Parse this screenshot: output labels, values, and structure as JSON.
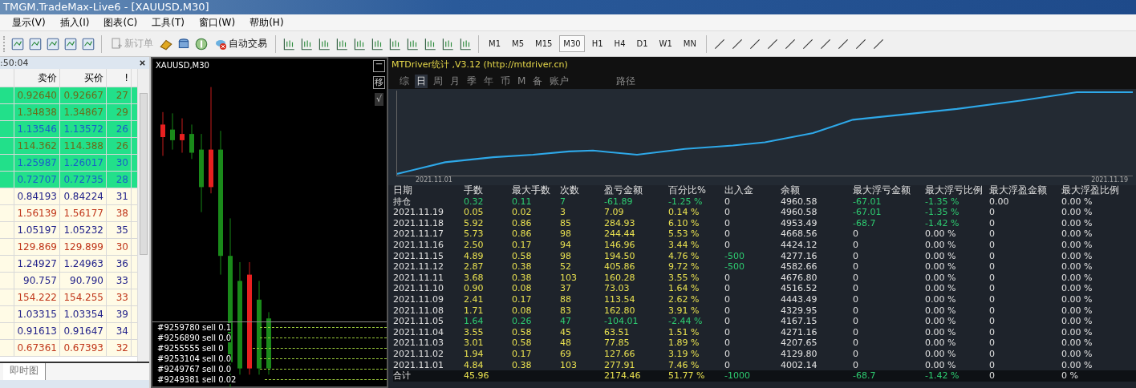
{
  "window": {
    "title": "TMGM.TradeMax-Live6 - [XAUUSD,M30]"
  },
  "menu": [
    "显示(V)",
    "插入(I)",
    "图表(C)",
    "工具(T)",
    "窗口(W)",
    "帮助(H)"
  ],
  "toolbar": {
    "new_order": {
      "label": "新订单",
      "disabled": true
    },
    "auto_trading": {
      "label": "自动交易"
    },
    "timeframes": [
      {
        "label": "M1",
        "selected": false
      },
      {
        "label": "M5",
        "selected": false
      },
      {
        "label": "M15",
        "selected": false
      },
      {
        "label": "M30",
        "selected": true
      },
      {
        "label": "H1",
        "selected": false
      },
      {
        "label": "H4",
        "selected": false
      },
      {
        "label": "D1",
        "selected": false
      },
      {
        "label": "W1",
        "selected": false
      },
      {
        "label": "MN",
        "selected": false
      }
    ]
  },
  "market_watch": {
    "time": ":50:04",
    "columns": [
      "卖价",
      "买价",
      "!"
    ],
    "rows": [
      {
        "bid": "0.92640",
        "ask": "0.92667",
        "spread": "27",
        "highlighted": true,
        "color": "#6b6b1a"
      },
      {
        "bid": "1.34838",
        "ask": "1.34867",
        "spread": "29",
        "highlighted": true,
        "color": "#6b6b1a"
      },
      {
        "bid": "1.13546",
        "ask": "1.13572",
        "spread": "26",
        "highlighted": true,
        "color": "#1a5fc8"
      },
      {
        "bid": "114.362",
        "ask": "114.388",
        "spread": "26",
        "highlighted": true,
        "color": "#6b6b1a"
      },
      {
        "bid": "1.25987",
        "ask": "1.26017",
        "spread": "30",
        "highlighted": true,
        "color": "#1a5fc8"
      },
      {
        "bid": "0.72707",
        "ask": "0.72735",
        "spread": "28",
        "highlighted": true,
        "color": "#1a5fc8"
      },
      {
        "bid": "0.84193",
        "ask": "0.84224",
        "spread": "31",
        "highlighted": false,
        "color": "#22228a"
      },
      {
        "bid": "1.56139",
        "ask": "1.56177",
        "spread": "38",
        "highlighted": false,
        "color": "#c0361a"
      },
      {
        "bid": "1.05197",
        "ask": "1.05232",
        "spread": "35",
        "highlighted": false,
        "color": "#22228a"
      },
      {
        "bid": "129.869",
        "ask": "129.899",
        "spread": "30",
        "highlighted": false,
        "color": "#c0361a"
      },
      {
        "bid": "1.24927",
        "ask": "1.24963",
        "spread": "36",
        "highlighted": false,
        "color": "#22228a"
      },
      {
        "bid": "90.757",
        "ask": "90.790",
        "spread": "33",
        "highlighted": false,
        "color": "#22228a"
      },
      {
        "bid": "154.222",
        "ask": "154.255",
        "spread": "33",
        "highlighted": false,
        "color": "#c0361a"
      },
      {
        "bid": "1.03315",
        "ask": "1.03354",
        "spread": "39",
        "highlighted": false,
        "color": "#22228a"
      },
      {
        "bid": "0.91613",
        "ask": "0.91647",
        "spread": "34",
        "highlighted": false,
        "color": "#22228a"
      },
      {
        "bid": "0.67361",
        "ask": "0.67393",
        "spread": "32",
        "highlighted": false,
        "color": "#c0361a"
      }
    ],
    "tabs": [
      "即时图"
    ]
  },
  "chart": {
    "symbol": "XAUUSD,M30",
    "side_buttons": [
      "移",
      "√"
    ],
    "orders": [
      "#9259780 sell 0.1",
      "#9256890 sell 0.0",
      "#9255555 sell 0",
      "#9253104 sell 0.0",
      "#9249767 sell 0.0",
      "#9249381 sell 0.02"
    ]
  },
  "stats": {
    "title": "MTDriver统计 ,V3.12 (http://mtdriver.cn)",
    "tabs": [
      {
        "label": "综",
        "selected": false
      },
      {
        "label": "日",
        "selected": true
      },
      {
        "label": "周",
        "selected": false
      },
      {
        "label": "月",
        "selected": false
      },
      {
        "label": "季",
        "selected": false
      },
      {
        "label": "年",
        "selected": false
      },
      {
        "label": "币",
        "selected": false
      },
      {
        "label": "M",
        "selected": false
      },
      {
        "label": "备",
        "selected": false
      },
      {
        "label": "账户",
        "selected": false
      },
      {
        "label": "路径",
        "selected": false
      }
    ],
    "curve_start": "2021.11.01",
    "curve_end": "2021.11.19",
    "columns": [
      "日期",
      "手数",
      "最大手数",
      "次数",
      "盈亏金额",
      "百分比%",
      "出入金",
      "余额",
      "最大浮亏金额",
      "最大浮亏比例",
      "最大浮盈金额",
      "最大浮盈比例"
    ],
    "rows": [
      [
        {
          "v": "持仓"
        },
        {
          "v": "0.32",
          "color": "#2ecc71"
        },
        {
          "v": "0.11",
          "color": "#2ecc71"
        },
        {
          "v": "7",
          "color": "#2ecc71"
        },
        {
          "v": "-61.89",
          "color": "#2ecc71"
        },
        {
          "v": "-1.25 %",
          "color": "#2ecc71"
        },
        {
          "v": "0",
          "color": "#e0e0e0"
        },
        {
          "v": "4960.58",
          "color": "#e0e0e0"
        },
        {
          "v": "-67.01",
          "color": "#2ecc71"
        },
        {
          "v": "-1.35 %",
          "color": "#2ecc71"
        },
        {
          "v": "0.00",
          "color": "#e0e0e0"
        },
        {
          "v": "0.00 %",
          "color": "#e0e0e0"
        }
      ],
      [
        {
          "v": "2021.11.19",
          "color": "#e0e0e0"
        },
        {
          "v": "0.05",
          "color": "#e8e050"
        },
        {
          "v": "0.02",
          "color": "#e8e050"
        },
        {
          "v": "3",
          "color": "#e8e050"
        },
        {
          "v": "7.09",
          "color": "#e8e050"
        },
        {
          "v": "0.14 %",
          "color": "#e8e050"
        },
        {
          "v": "0",
          "color": "#e0e0e0"
        },
        {
          "v": "4960.58",
          "color": "#e0e0e0"
        },
        {
          "v": "-67.01",
          "color": "#2ecc71"
        },
        {
          "v": "-1.35 %",
          "color": "#2ecc71"
        },
        {
          "v": "0",
          "color": "#e0e0e0"
        },
        {
          "v": "0.00 %",
          "color": "#e0e0e0"
        }
      ],
      [
        {
          "v": "2021.11.18",
          "color": "#e0e0e0"
        },
        {
          "v": "5.92",
          "color": "#e8e050"
        },
        {
          "v": "0.86",
          "color": "#e8e050"
        },
        {
          "v": "85",
          "color": "#e8e050"
        },
        {
          "v": "284.93",
          "color": "#e8e050"
        },
        {
          "v": "6.10 %",
          "color": "#e8e050"
        },
        {
          "v": "0",
          "color": "#e0e0e0"
        },
        {
          "v": "4953.49",
          "color": "#e0e0e0"
        },
        {
          "v": "-68.7",
          "color": "#2ecc71"
        },
        {
          "v": "-1.42 %",
          "color": "#2ecc71"
        },
        {
          "v": "0",
          "color": "#e0e0e0"
        },
        {
          "v": "0.00 %",
          "color": "#e0e0e0"
        }
      ],
      [
        {
          "v": "2021.11.17",
          "color": "#e0e0e0"
        },
        {
          "v": "5.73",
          "color": "#e8e050"
        },
        {
          "v": "0.86",
          "color": "#e8e050"
        },
        {
          "v": "98",
          "color": "#e8e050"
        },
        {
          "v": "244.44",
          "color": "#e8e050"
        },
        {
          "v": "5.53 %",
          "color": "#e8e050"
        },
        {
          "v": "0",
          "color": "#e0e0e0"
        },
        {
          "v": "4668.56",
          "color": "#e0e0e0"
        },
        {
          "v": "0",
          "color": "#e0e0e0"
        },
        {
          "v": "0.00 %",
          "color": "#e0e0e0"
        },
        {
          "v": "0",
          "color": "#e0e0e0"
        },
        {
          "v": "0.00 %",
          "color": "#e0e0e0"
        }
      ],
      [
        {
          "v": "2021.11.16",
          "color": "#e0e0e0"
        },
        {
          "v": "2.50",
          "color": "#e8e050"
        },
        {
          "v": "0.17",
          "color": "#e8e050"
        },
        {
          "v": "94",
          "color": "#e8e050"
        },
        {
          "v": "146.96",
          "color": "#e8e050"
        },
        {
          "v": "3.44 %",
          "color": "#e8e050"
        },
        {
          "v": "0",
          "color": "#e0e0e0"
        },
        {
          "v": "4424.12",
          "color": "#e0e0e0"
        },
        {
          "v": "0",
          "color": "#e0e0e0"
        },
        {
          "v": "0.00 %",
          "color": "#e0e0e0"
        },
        {
          "v": "0",
          "color": "#e0e0e0"
        },
        {
          "v": "0.00 %",
          "color": "#e0e0e0"
        }
      ],
      [
        {
          "v": "2021.11.15",
          "color": "#e0e0e0"
        },
        {
          "v": "4.89",
          "color": "#e8e050"
        },
        {
          "v": "0.58",
          "color": "#e8e050"
        },
        {
          "v": "98",
          "color": "#e8e050"
        },
        {
          "v": "194.50",
          "color": "#e8e050"
        },
        {
          "v": "4.76 %",
          "color": "#e8e050"
        },
        {
          "v": "-500",
          "color": "#2ecc71"
        },
        {
          "v": "4277.16",
          "color": "#e0e0e0"
        },
        {
          "v": "0",
          "color": "#e0e0e0"
        },
        {
          "v": "0.00 %",
          "color": "#e0e0e0"
        },
        {
          "v": "0",
          "color": "#e0e0e0"
        },
        {
          "v": "0.00 %",
          "color": "#e0e0e0"
        }
      ],
      [
        {
          "v": "2021.11.12",
          "color": "#e0e0e0"
        },
        {
          "v": "2.87",
          "color": "#e8e050"
        },
        {
          "v": "0.38",
          "color": "#e8e050"
        },
        {
          "v": "52",
          "color": "#e8e050"
        },
        {
          "v": "405.86",
          "color": "#e8e050"
        },
        {
          "v": "9.72 %",
          "color": "#e8e050"
        },
        {
          "v": "-500",
          "color": "#2ecc71"
        },
        {
          "v": "4582.66",
          "color": "#e0e0e0"
        },
        {
          "v": "0",
          "color": "#e0e0e0"
        },
        {
          "v": "0.00 %",
          "color": "#e0e0e0"
        },
        {
          "v": "0",
          "color": "#e0e0e0"
        },
        {
          "v": "0.00 %",
          "color": "#e0e0e0"
        }
      ],
      [
        {
          "v": "2021.11.11",
          "color": "#e0e0e0"
        },
        {
          "v": "3.68",
          "color": "#e8e050"
        },
        {
          "v": "0.38",
          "color": "#e8e050"
        },
        {
          "v": "103",
          "color": "#e8e050"
        },
        {
          "v": "160.28",
          "color": "#e8e050"
        },
        {
          "v": "3.55 %",
          "color": "#e8e050"
        },
        {
          "v": "0",
          "color": "#e0e0e0"
        },
        {
          "v": "4676.80",
          "color": "#e0e0e0"
        },
        {
          "v": "0",
          "color": "#e0e0e0"
        },
        {
          "v": "0.00 %",
          "color": "#e0e0e0"
        },
        {
          "v": "0",
          "color": "#e0e0e0"
        },
        {
          "v": "0.00 %",
          "color": "#e0e0e0"
        }
      ],
      [
        {
          "v": "2021.11.10",
          "color": "#e0e0e0"
        },
        {
          "v": "0.90",
          "color": "#e8e050"
        },
        {
          "v": "0.08",
          "color": "#e8e050"
        },
        {
          "v": "37",
          "color": "#e8e050"
        },
        {
          "v": "73.03",
          "color": "#e8e050"
        },
        {
          "v": "1.64 %",
          "color": "#e8e050"
        },
        {
          "v": "0",
          "color": "#e0e0e0"
        },
        {
          "v": "4516.52",
          "color": "#e0e0e0"
        },
        {
          "v": "0",
          "color": "#e0e0e0"
        },
        {
          "v": "0.00 %",
          "color": "#e0e0e0"
        },
        {
          "v": "0",
          "color": "#e0e0e0"
        },
        {
          "v": "0.00 %",
          "color": "#e0e0e0"
        }
      ],
      [
        {
          "v": "2021.11.09",
          "color": "#e0e0e0"
        },
        {
          "v": "2.41",
          "color": "#e8e050"
        },
        {
          "v": "0.17",
          "color": "#e8e050"
        },
        {
          "v": "88",
          "color": "#e8e050"
        },
        {
          "v": "113.54",
          "color": "#e8e050"
        },
        {
          "v": "2.62 %",
          "color": "#e8e050"
        },
        {
          "v": "0",
          "color": "#e0e0e0"
        },
        {
          "v": "4443.49",
          "color": "#e0e0e0"
        },
        {
          "v": "0",
          "color": "#e0e0e0"
        },
        {
          "v": "0.00 %",
          "color": "#e0e0e0"
        },
        {
          "v": "0",
          "color": "#e0e0e0"
        },
        {
          "v": "0.00 %",
          "color": "#e0e0e0"
        }
      ],
      [
        {
          "v": "2021.11.08",
          "color": "#e0e0e0"
        },
        {
          "v": "1.71",
          "color": "#e8e050"
        },
        {
          "v": "0.08",
          "color": "#e8e050"
        },
        {
          "v": "83",
          "color": "#e8e050"
        },
        {
          "v": "162.80",
          "color": "#e8e050"
        },
        {
          "v": "3.91 %",
          "color": "#e8e050"
        },
        {
          "v": "0",
          "color": "#e0e0e0"
        },
        {
          "v": "4329.95",
          "color": "#e0e0e0"
        },
        {
          "v": "0",
          "color": "#e0e0e0"
        },
        {
          "v": "0.00 %",
          "color": "#e0e0e0"
        },
        {
          "v": "0",
          "color": "#e0e0e0"
        },
        {
          "v": "0.00 %",
          "color": "#e0e0e0"
        }
      ],
      [
        {
          "v": "2021.11.05",
          "color": "#e0e0e0"
        },
        {
          "v": "1.64",
          "color": "#2ecc71"
        },
        {
          "v": "0.26",
          "color": "#2ecc71"
        },
        {
          "v": "47",
          "color": "#2ecc71"
        },
        {
          "v": "-104.01",
          "color": "#2ecc71"
        },
        {
          "v": "-2.44 %",
          "color": "#2ecc71"
        },
        {
          "v": "0",
          "color": "#e0e0e0"
        },
        {
          "v": "4167.15",
          "color": "#e0e0e0"
        },
        {
          "v": "0",
          "color": "#e0e0e0"
        },
        {
          "v": "0.00 %",
          "color": "#e0e0e0"
        },
        {
          "v": "0",
          "color": "#e0e0e0"
        },
        {
          "v": "0.00 %",
          "color": "#e0e0e0"
        }
      ],
      [
        {
          "v": "2021.11.04",
          "color": "#e0e0e0"
        },
        {
          "v": "3.55",
          "color": "#e8e050"
        },
        {
          "v": "0.58",
          "color": "#e8e050"
        },
        {
          "v": "45",
          "color": "#e8e050"
        },
        {
          "v": "63.51",
          "color": "#e8e050"
        },
        {
          "v": "1.51 %",
          "color": "#e8e050"
        },
        {
          "v": "0",
          "color": "#e0e0e0"
        },
        {
          "v": "4271.16",
          "color": "#e0e0e0"
        },
        {
          "v": "0",
          "color": "#e0e0e0"
        },
        {
          "v": "0.00 %",
          "color": "#e0e0e0"
        },
        {
          "v": "0",
          "color": "#e0e0e0"
        },
        {
          "v": "0.00 %",
          "color": "#e0e0e0"
        }
      ],
      [
        {
          "v": "2021.11.03",
          "color": "#e0e0e0"
        },
        {
          "v": "3.01",
          "color": "#e8e050"
        },
        {
          "v": "0.58",
          "color": "#e8e050"
        },
        {
          "v": "48",
          "color": "#e8e050"
        },
        {
          "v": "77.85",
          "color": "#e8e050"
        },
        {
          "v": "1.89 %",
          "color": "#e8e050"
        },
        {
          "v": "0",
          "color": "#e0e0e0"
        },
        {
          "v": "4207.65",
          "color": "#e0e0e0"
        },
        {
          "v": "0",
          "color": "#e0e0e0"
        },
        {
          "v": "0.00 %",
          "color": "#e0e0e0"
        },
        {
          "v": "0",
          "color": "#e0e0e0"
        },
        {
          "v": "0.00 %",
          "color": "#e0e0e0"
        }
      ],
      [
        {
          "v": "2021.11.02",
          "color": "#e0e0e0"
        },
        {
          "v": "1.94",
          "color": "#e8e050"
        },
        {
          "v": "0.17",
          "color": "#e8e050"
        },
        {
          "v": "69",
          "color": "#e8e050"
        },
        {
          "v": "127.66",
          "color": "#e8e050"
        },
        {
          "v": "3.19 %",
          "color": "#e8e050"
        },
        {
          "v": "0",
          "color": "#e0e0e0"
        },
        {
          "v": "4129.80",
          "color": "#e0e0e0"
        },
        {
          "v": "0",
          "color": "#e0e0e0"
        },
        {
          "v": "0.00 %",
          "color": "#e0e0e0"
        },
        {
          "v": "0",
          "color": "#e0e0e0"
        },
        {
          "v": "0.00 %",
          "color": "#e0e0e0"
        }
      ],
      [
        {
          "v": "2021.11.01",
          "color": "#e0e0e0"
        },
        {
          "v": "4.84",
          "color": "#e8e050"
        },
        {
          "v": "0.38",
          "color": "#e8e050"
        },
        {
          "v": "103",
          "color": "#e8e050"
        },
        {
          "v": "277.91",
          "color": "#e8e050"
        },
        {
          "v": "7.46 %",
          "color": "#e8e050"
        },
        {
          "v": "0",
          "color": "#e0e0e0"
        },
        {
          "v": "4002.14",
          "color": "#e0e0e0"
        },
        {
          "v": "0",
          "color": "#e0e0e0"
        },
        {
          "v": "0.00 %",
          "color": "#e0e0e0"
        },
        {
          "v": "0",
          "color": "#e0e0e0"
        },
        {
          "v": "0.00 %",
          "color": "#e0e0e0"
        }
      ]
    ],
    "total": {
      "label": "合计",
      "lots": {
        "v": "45.96",
        "color": "#e8e050"
      },
      "profit": {
        "v": "2174.46",
        "color": "#e8e050"
      },
      "percent": {
        "v": "51.77 %",
        "color": "#e8e050"
      },
      "flow": {
        "v": "-1000",
        "color": "#2ecc71"
      },
      "max_float_loss": {
        "v": "-68.7",
        "color": "#2ecc71"
      },
      "max_float_loss_pct": {
        "v": "-1.42 %",
        "color": "#2ecc71"
      },
      "max_float_profit": {
        "v": "0",
        "color": "#e0e0e0"
      },
      "max_float_profit_pct": {
        "v": "0 %",
        "color": "#e0e0e0"
      }
    }
  }
}
